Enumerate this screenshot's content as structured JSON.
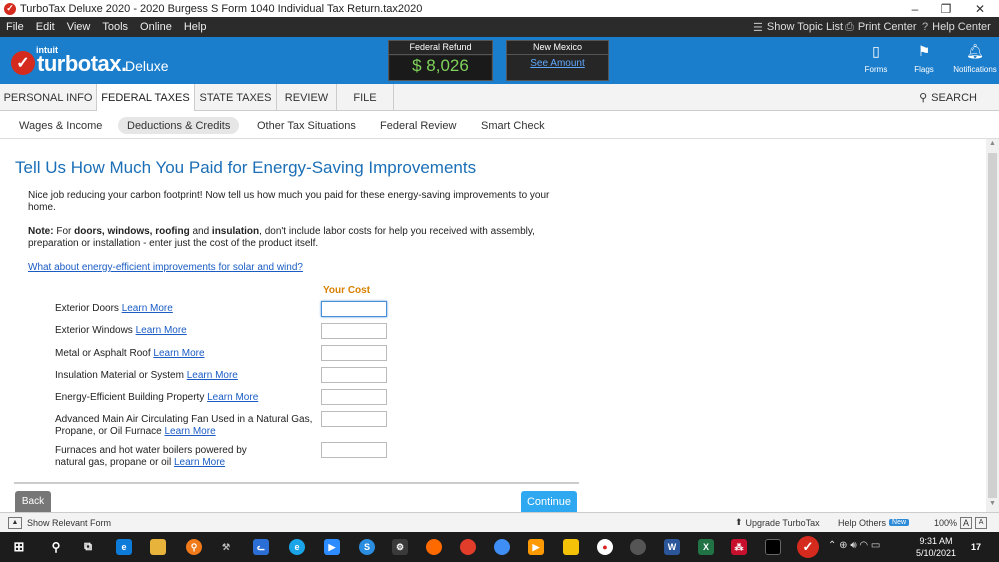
{
  "window": {
    "title": "TurboTax Deluxe 2020 - 2020 Burgess S Form 1040  Individual Tax Return.tax2020",
    "controls": [
      "–",
      "❐",
      "✕"
    ]
  },
  "menu": {
    "items": [
      "File",
      "Edit",
      "View",
      "Tools",
      "Online",
      "Help"
    ],
    "show_topic_list": "Show Topic List",
    "print_center": "Print Center",
    "help_center": "Help Center"
  },
  "header": {
    "brand_small": "intuit",
    "brand": "turbotax.",
    "edition": "Deluxe",
    "federal_refund_label": "Federal Refund",
    "federal_refund_amount": "$ 8,026",
    "state_label": "New Mexico",
    "state_link": "See Amount",
    "icons": [
      "Forms",
      "Flags",
      "Notifications"
    ]
  },
  "tabs": {
    "items": [
      "PERSONAL INFO",
      "FEDERAL TAXES",
      "STATE TAXES",
      "REVIEW",
      "FILE"
    ],
    "active": "FEDERAL TAXES",
    "search": "SEARCH"
  },
  "subtabs": {
    "items": [
      "Wages & Income",
      "Deductions & Credits",
      "Other Tax Situations",
      "Federal Review",
      "Smart Check"
    ],
    "active": "Deductions & Credits"
  },
  "main": {
    "title": "Tell Us How Much You Paid for Energy-Saving Improvements",
    "intro": "Nice job reducing your carbon footprint! Now tell us how much you paid for these energy-saving improvements to your home.",
    "note_label": "Note:",
    "note_pre": " For ",
    "note_bold": "doors, windows, roofing",
    "note_and": " and ",
    "note_bold2": "insulation",
    "note_rest": ", don't include labor costs for help you received with assembly, preparation or installation - enter just the cost of the product itself.",
    "solar_link": "What about energy-efficient improvements for solar and wind?",
    "cost_header": "Your Cost",
    "learn_more": "Learn More",
    "rows": [
      {
        "label": "Exterior Doors",
        "value": ""
      },
      {
        "label": "Exterior Windows",
        "value": ""
      },
      {
        "label": "Metal or Asphalt Roof",
        "value": ""
      },
      {
        "label": "Insulation Material or System",
        "value": ""
      },
      {
        "label": "Energy-Efficient Building Property",
        "value": ""
      },
      {
        "label": "Advanced Main Air Circulating Fan Used in a Natural Gas, Propane, or Oil Furnace",
        "value": ""
      },
      {
        "label": "Furnaces and hot water boilers powered by natural gas, propane or oil",
        "value": ""
      }
    ],
    "back": "Back",
    "continue": "Continue"
  },
  "statusbar": {
    "show_form": "Show Relevant Form",
    "upgrade": "Upgrade TurboTax",
    "help_others": "Help Others",
    "new_badge": "New",
    "zoom": "100%",
    "zoom_a": "A",
    "zoom_a2": "A"
  },
  "taskbar": {
    "time": "9:31 AM",
    "date": "5/10/2021",
    "notif_count": "17"
  },
  "colors": {
    "header_blue": "#1b7ecc",
    "title_blue": "#1b6fb7",
    "cost_orange": "#d98000",
    "continue_blue": "#2ea8f0",
    "refund_green": "#7fd35a"
  }
}
